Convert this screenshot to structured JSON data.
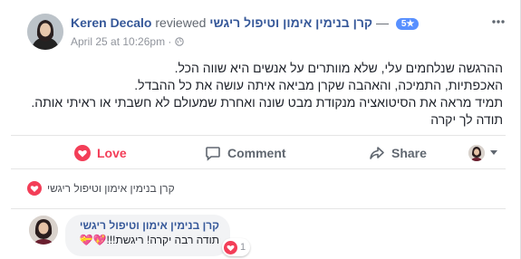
{
  "post": {
    "author": "Keren Decalo",
    "action": "reviewed",
    "page_name": "קרן בנימין אימון וטיפול ריגשי",
    "separator": "—",
    "rating": "5",
    "star": "★",
    "timestamp": "April 25 at 10:26pm",
    "dot": "·",
    "body_lines": [
      "ההרגשה שנלחמים עלי, שלא מוותרים על אנשים היא שווה הכל.",
      "האכפתיות, התמיכה, והאהבה שקרן מביאה איתה עושה את כל ההבדל.",
      "תמיד מראה את הסיטואציה מנקודת מבט שונה ואחרת שמעולם לא חשבתי או ראיתי אותה. תודה לך יקרה"
    ]
  },
  "actions": {
    "love": "Love",
    "comment": "Comment",
    "share": "Share"
  },
  "reactions": {
    "page_name": "קרן בנימין אימון וטיפול ריגשי"
  },
  "comment": {
    "author": "קרן בנימין אימון וטיפול ריגשי",
    "text": "תודה רבה יקרה! ריגשת!!!",
    "hearts": "💖💝",
    "reaction_count": "1"
  },
  "colors": {
    "link": "#365899",
    "love": "#f33e58",
    "rating_badge": "#5890ff"
  }
}
